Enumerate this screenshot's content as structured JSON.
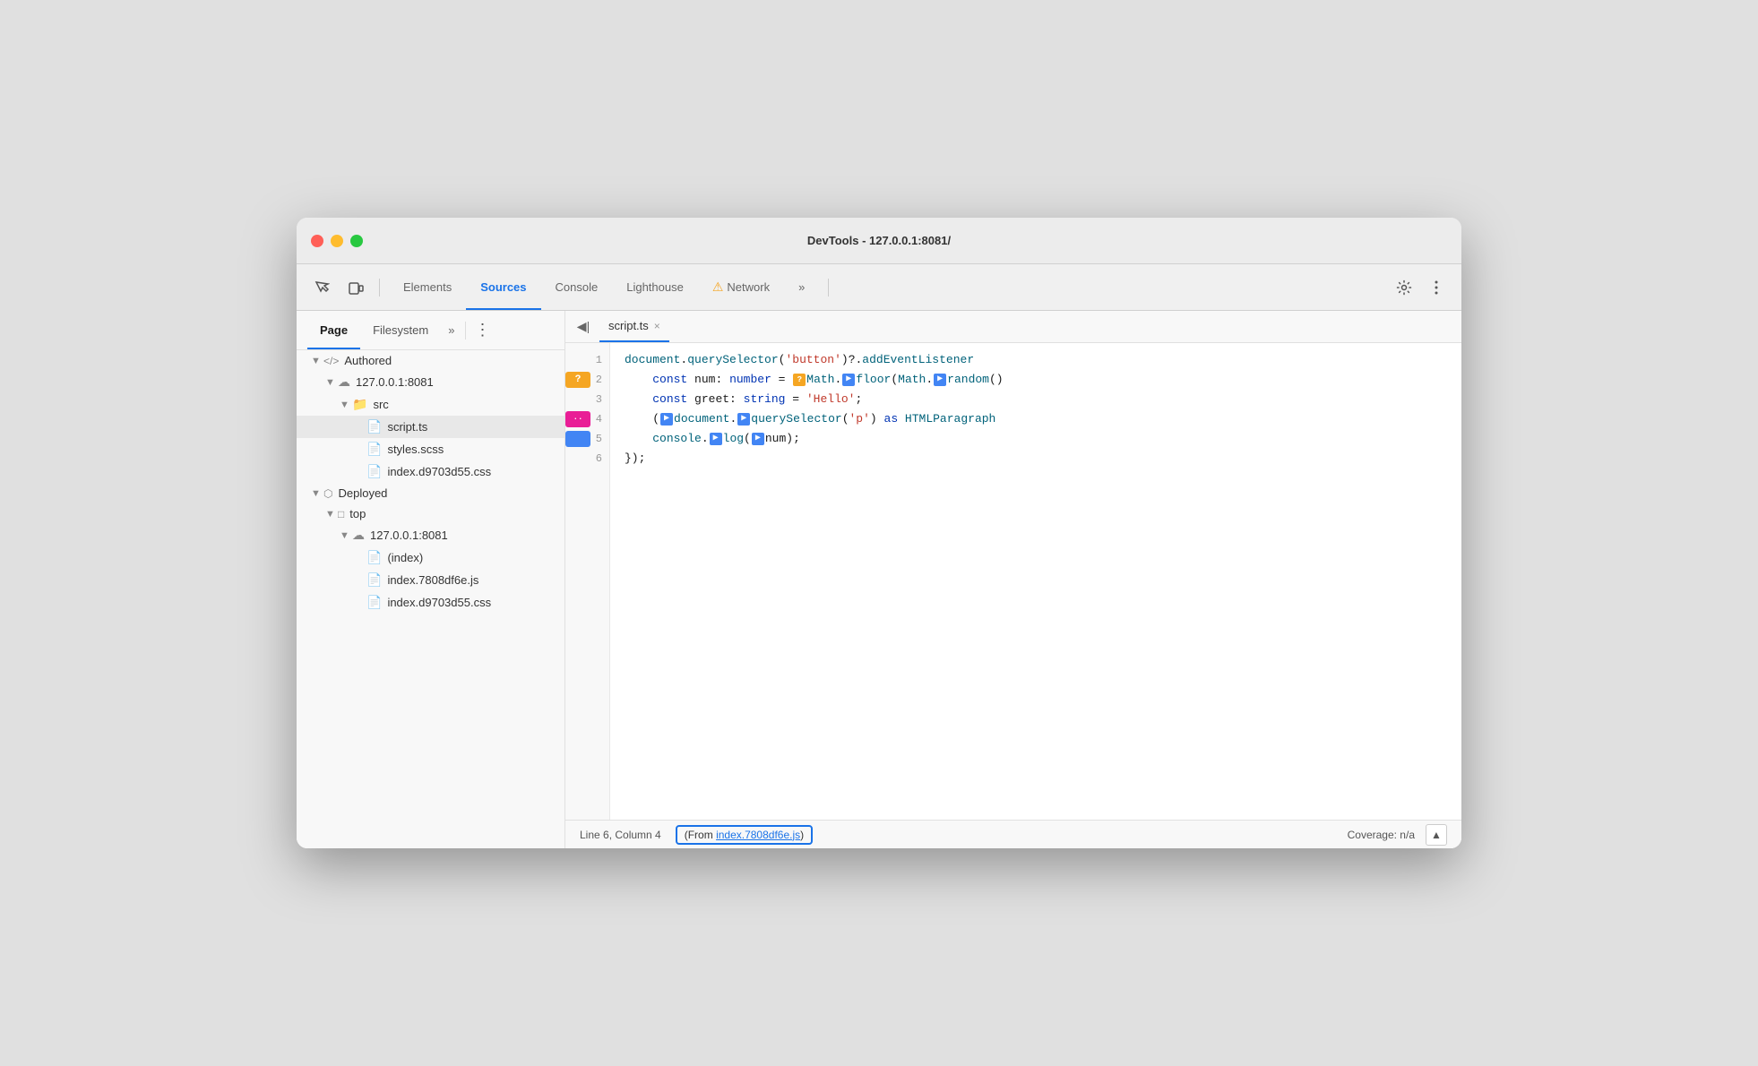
{
  "titlebar": {
    "title": "DevTools - 127.0.0.1:8081/"
  },
  "toolbar": {
    "tabs": [
      {
        "id": "elements",
        "label": "Elements",
        "active": false,
        "warning": false
      },
      {
        "id": "sources",
        "label": "Sources",
        "active": true,
        "warning": false
      },
      {
        "id": "console",
        "label": "Console",
        "active": false,
        "warning": false
      },
      {
        "id": "lighthouse",
        "label": "Lighthouse",
        "active": false,
        "warning": false
      },
      {
        "id": "network",
        "label": "Network",
        "active": false,
        "warning": true
      }
    ],
    "more_label": "»"
  },
  "subtoolbar": {
    "tabs": [
      {
        "id": "page",
        "label": "Page",
        "active": true
      },
      {
        "id": "filesystem",
        "label": "Filesystem",
        "active": false
      }
    ],
    "more_label": "»",
    "menu_label": "⋮"
  },
  "editor": {
    "side_btn": "◀|",
    "tab_label": "script.ts",
    "tab_close": "×"
  },
  "file_tree": {
    "items": [
      {
        "indent": 1,
        "arrow": "▼",
        "icon": "</>",
        "icon_color": "#888",
        "label": "Authored",
        "type": "section"
      },
      {
        "indent": 2,
        "arrow": "▼",
        "icon": "☁",
        "icon_color": "#888",
        "label": "127.0.0.1:8081",
        "type": "host"
      },
      {
        "indent": 3,
        "arrow": "▼",
        "icon": "📁",
        "icon_color": "#e67e22",
        "label": "src",
        "type": "folder"
      },
      {
        "indent": 4,
        "arrow": "",
        "icon": "📄",
        "icon_color": "#f5a623",
        "label": "script.ts",
        "type": "file",
        "selected": true
      },
      {
        "indent": 4,
        "arrow": "",
        "icon": "📄",
        "icon_color": "#aaa",
        "label": "styles.scss",
        "type": "file"
      },
      {
        "indent": 4,
        "arrow": "",
        "icon": "📄",
        "icon_color": "#7c4dff",
        "label": "index.d9703d55.css",
        "type": "file"
      },
      {
        "indent": 1,
        "arrow": "▼",
        "icon": "⬡",
        "icon_color": "#888",
        "label": "Deployed",
        "type": "section"
      },
      {
        "indent": 2,
        "arrow": "▼",
        "icon": "□",
        "icon_color": "#888",
        "label": "top",
        "type": "folder"
      },
      {
        "indent": 3,
        "arrow": "▼",
        "icon": "☁",
        "icon_color": "#888",
        "label": "127.0.0.1:8081",
        "type": "host"
      },
      {
        "indent": 4,
        "arrow": "",
        "icon": "📄",
        "icon_color": "#aaa",
        "label": "(index)",
        "type": "file"
      },
      {
        "indent": 4,
        "arrow": "",
        "icon": "📄",
        "icon_color": "#f5a623",
        "label": "index.7808df6e.js",
        "type": "file"
      },
      {
        "indent": 4,
        "arrow": "",
        "icon": "📄",
        "icon_color": "#7c4dff",
        "label": "index.d9703d55.css",
        "type": "file"
      }
    ]
  },
  "code": {
    "lines": [
      {
        "num": "1",
        "badge": null,
        "content": "document.querySelector('button')?.addEventListener"
      },
      {
        "num": "2",
        "badge": {
          "type": "orange",
          "text": "?"
        },
        "content": "    const num: number = Math.floor(Math.random()"
      },
      {
        "num": "3",
        "badge": null,
        "content": "    const greet: string = 'Hello';"
      },
      {
        "num": "4",
        "badge": {
          "type": "pink",
          "text": "··"
        },
        "content": "    (document.querySelector('p') as HTMLParagrap"
      },
      {
        "num": "5",
        "badge": {
          "type": "blue",
          "text": ""
        },
        "content": "    console.log(num);"
      },
      {
        "num": "6",
        "badge": null,
        "content": "});"
      }
    ]
  },
  "statusbar": {
    "position": "Line 6, Column 4",
    "source_label": "(From index.7808df6e.js)",
    "source_link": "index.7808df6e.js",
    "coverage": "Coverage: n/a",
    "coverage_btn": "▲"
  }
}
